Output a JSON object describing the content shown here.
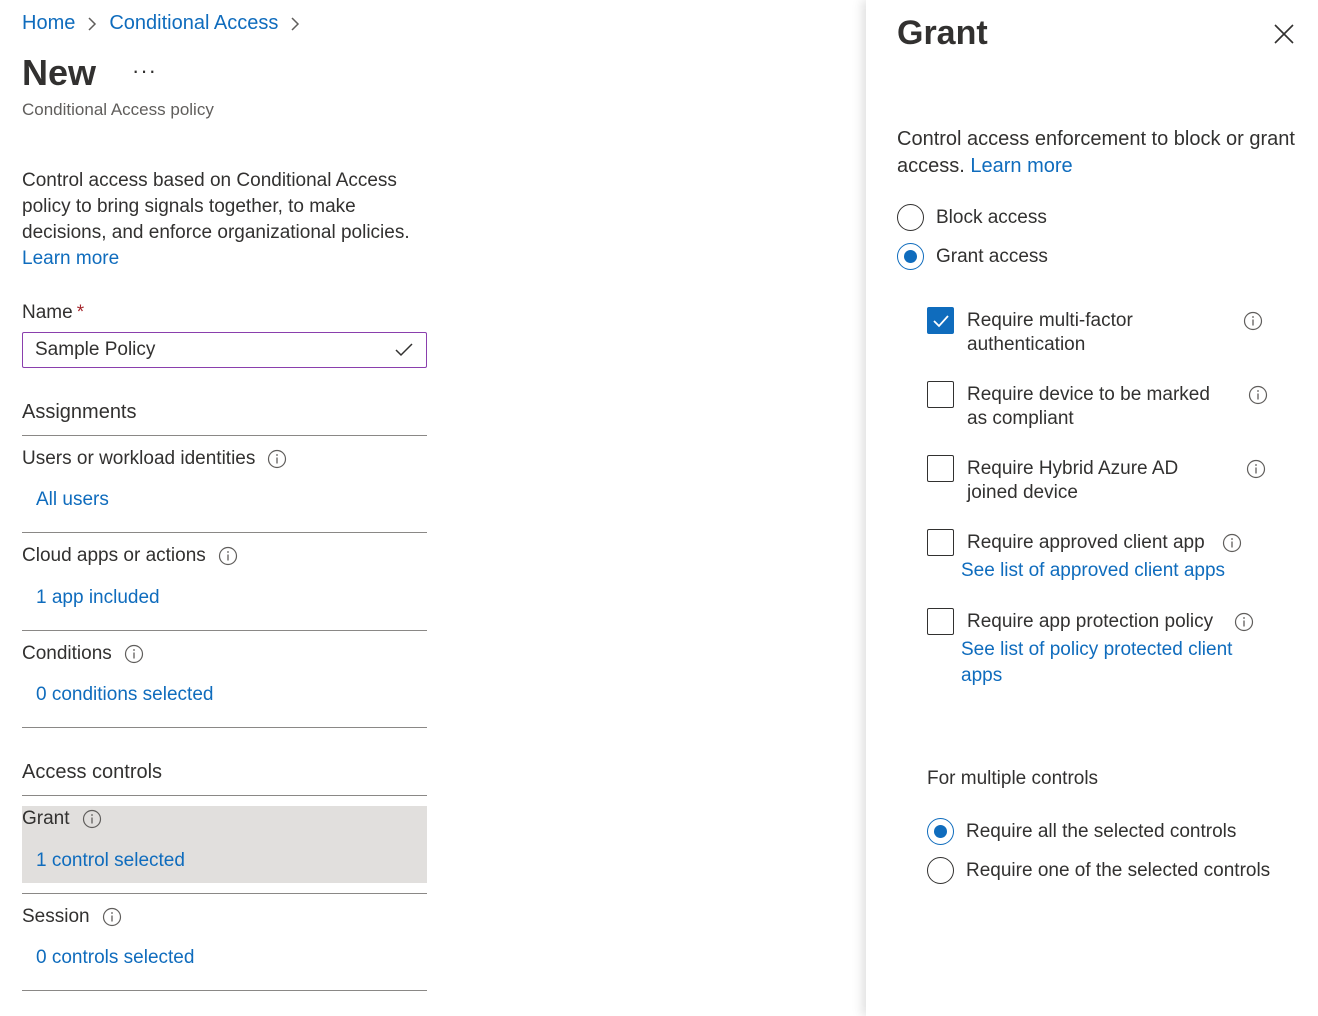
{
  "breadcrumb": {
    "home": "Home",
    "conditional_access": "Conditional Access"
  },
  "page": {
    "title": "New",
    "more": "···",
    "subtitle": "Conditional Access policy",
    "description": "Control access based on Conditional Access policy to bring signals together, to make decisions, and enforce organizational policies.",
    "learn_more": "Learn more"
  },
  "name_field": {
    "label": "Name",
    "required_mark": "*",
    "value": "Sample Policy"
  },
  "assignments": {
    "title": "Assignments",
    "users": {
      "label": "Users or workload identities",
      "value": "All users"
    },
    "cloud_apps": {
      "label": "Cloud apps or actions",
      "value": "1 app included"
    },
    "conditions": {
      "label": "Conditions",
      "value": "0 conditions selected"
    }
  },
  "access_controls": {
    "title": "Access controls",
    "grant": {
      "label": "Grant",
      "value": "1 control selected"
    },
    "session": {
      "label": "Session",
      "value": "0 controls selected"
    }
  },
  "grant_panel": {
    "title": "Grant",
    "description": "Control access enforcement to block or grant access.",
    "learn_more": "Learn more",
    "access_options": [
      {
        "label": "Block access",
        "selected": false
      },
      {
        "label": "Grant access",
        "selected": true
      }
    ],
    "controls": [
      {
        "label_line1": "Require multi-factor",
        "label_line2": "authentication",
        "checked": true
      },
      {
        "label_line1": "Require device to be marked",
        "label_line2": "as compliant",
        "checked": false
      },
      {
        "label_line1": "Require Hybrid Azure AD",
        "label_line2": "joined device",
        "checked": false
      },
      {
        "label_line1": "Require approved client app",
        "link": "See list of approved client apps",
        "checked": false
      },
      {
        "label_line1": "Require app protection policy",
        "link_line1": "See list of policy protected client",
        "link_line2": "apps",
        "checked": false
      }
    ],
    "multiple_controls": {
      "label": "For multiple controls",
      "options": [
        {
          "label": "Require all the selected controls",
          "selected": true
        },
        {
          "label": "Require one of the selected controls",
          "selected": false
        }
      ]
    }
  },
  "colors": {
    "link": "#0f6cbd",
    "selection_bg": "#e1dfdd",
    "input_border": "#8a3fad",
    "required": "#a4262c"
  }
}
